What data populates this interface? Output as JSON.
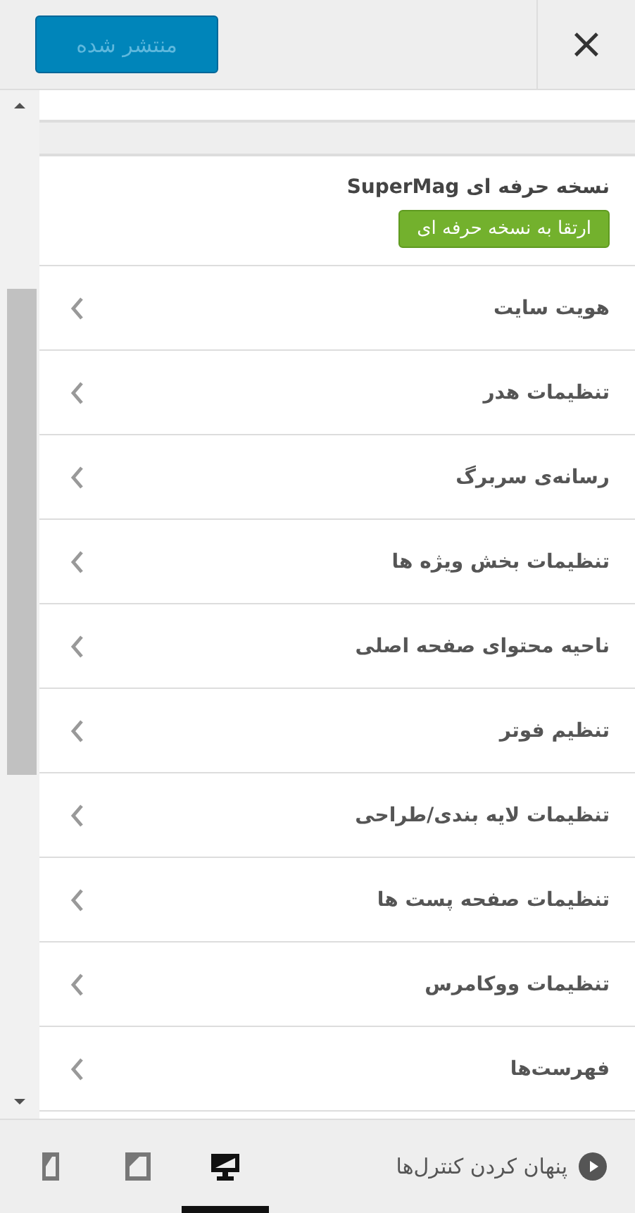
{
  "header": {
    "publish_button": "منتشر شده",
    "close_button": "×"
  },
  "pro_section": {
    "title": "نسخه حرفه ای SuperMag",
    "upgrade_button": "ارتقا به نسخه حرفه ای"
  },
  "sections": [
    {
      "label": "هویت سایت"
    },
    {
      "label": "تنظیمات هدر"
    },
    {
      "label": "رسانه‌ی سربرگ"
    },
    {
      "label": "تنظیمات بخش ویژه ها"
    },
    {
      "label": "ناحیه محتوای صفحه اصلی"
    },
    {
      "label": "تنظیم فوتر"
    },
    {
      "label": "تنظیمات لایه بندی/طراحی"
    },
    {
      "label": "تنظیمات صفحه پست ها"
    },
    {
      "label": "تنظیمات ووکامرس"
    },
    {
      "label": "فهرست‌ها"
    }
  ],
  "footer": {
    "hide_controls": "پنهان کردن کنترل‌ها",
    "devices": [
      {
        "kind": "desktop",
        "selected": true
      },
      {
        "kind": "tablet",
        "selected": false
      },
      {
        "kind": "mobile",
        "selected": false
      }
    ]
  }
}
